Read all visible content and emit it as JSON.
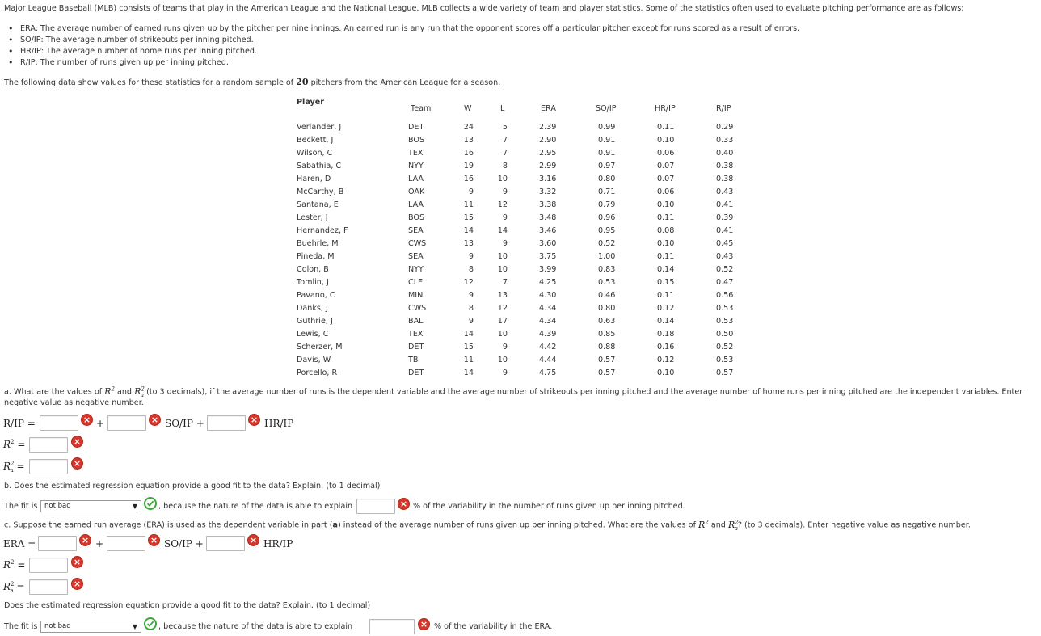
{
  "intro": "Major League Baseball (MLB) consists of teams that play in the American League and the National League. MLB collects a wide variety of team and player statistics. Some of the statistics often used to evaluate pitching performance are as follows:",
  "bullets": [
    "ERA: The average number of earned runs given up by the pitcher per nine innings. An earned run is any run that the opponent scores off a particular pitcher except for runs scored as a result of errors.",
    "SO/IP: The average number of strikeouts per inning pitched.",
    "HR/IP: The average number of home runs per inning pitched.",
    "R/IP: The number of runs given up per inning pitched."
  ],
  "following_pre": "The following data show values for these statistics for a random sample of ",
  "following_num": "20",
  "following_post": " pitchers from the American League for a season.",
  "table": {
    "player_header": "Player",
    "headers": [
      "Team",
      "W",
      "L",
      "ERA",
      "SO/IP",
      "HR/IP",
      "R/IP"
    ],
    "rows": [
      [
        "Verlander, J",
        "DET",
        "24",
        "5",
        "2.39",
        "0.99",
        "0.11",
        "0.29"
      ],
      [
        "Beckett, J",
        "BOS",
        "13",
        "7",
        "2.90",
        "0.91",
        "0.10",
        "0.33"
      ],
      [
        "Wilson, C",
        "TEX",
        "16",
        "7",
        "2.95",
        "0.91",
        "0.06",
        "0.40"
      ],
      [
        "Sabathia, C",
        "NYY",
        "19",
        "8",
        "2.99",
        "0.97",
        "0.07",
        "0.38"
      ],
      [
        "Haren, D",
        "LAA",
        "16",
        "10",
        "3.16",
        "0.80",
        "0.07",
        "0.38"
      ],
      [
        "McCarthy, B",
        "OAK",
        "9",
        "9",
        "3.32",
        "0.71",
        "0.06",
        "0.43"
      ],
      [
        "Santana, E",
        "LAA",
        "11",
        "12",
        "3.38",
        "0.79",
        "0.10",
        "0.41"
      ],
      [
        "Lester, J",
        "BOS",
        "15",
        "9",
        "3.48",
        "0.96",
        "0.11",
        "0.39"
      ],
      [
        "Hernandez, F",
        "SEA",
        "14",
        "14",
        "3.46",
        "0.95",
        "0.08",
        "0.41"
      ],
      [
        "Buehrle, M",
        "CWS",
        "13",
        "9",
        "3.60",
        "0.52",
        "0.10",
        "0.45"
      ],
      [
        "Pineda, M",
        "SEA",
        "9",
        "10",
        "3.75",
        "1.00",
        "0.11",
        "0.43"
      ],
      [
        "Colon, B",
        "NYY",
        "8",
        "10",
        "3.99",
        "0.83",
        "0.14",
        "0.52"
      ],
      [
        "Tomlin, J",
        "CLE",
        "12",
        "7",
        "4.25",
        "0.53",
        "0.15",
        "0.47"
      ],
      [
        "Pavano, C",
        "MIN",
        "9",
        "13",
        "4.30",
        "0.46",
        "0.11",
        "0.56"
      ],
      [
        "Danks, J",
        "CWS",
        "8",
        "12",
        "4.34",
        "0.80",
        "0.12",
        "0.53"
      ],
      [
        "Guthrie, J",
        "BAL",
        "9",
        "17",
        "4.34",
        "0.63",
        "0.14",
        "0.53"
      ],
      [
        "Lewis, C",
        "TEX",
        "14",
        "10",
        "4.39",
        "0.85",
        "0.18",
        "0.50"
      ],
      [
        "Scherzer, M",
        "DET",
        "15",
        "9",
        "4.42",
        "0.88",
        "0.16",
        "0.52"
      ],
      [
        "Davis, W",
        "TB",
        "11",
        "10",
        "4.44",
        "0.57",
        "0.12",
        "0.53"
      ],
      [
        "Porcello, R",
        "DET",
        "14",
        "9",
        "4.75",
        "0.57",
        "0.10",
        "0.57"
      ]
    ]
  },
  "part_a": {
    "question_1": "a. What are the values of ",
    "r2": "R²",
    "and": " and ",
    "ra2": "R",
    "ra2_sub": "a",
    "ra2_sup": "2",
    "question_2": " (to 3 decimals), if the average number of runs is the dependent variable and the average number of strikeouts per inning pitched and the average number of home runs per inning pitched are the independent variables. Enter",
    "question_3": "negative value as negative number.",
    "eq_lhs": "R/IP =",
    "plus": "+",
    "so_term": "SO/IP +",
    "hr_term": "HR/IP",
    "r2_label": "R² =",
    "ra2_label": "=",
    "inputs": {
      "b0": "",
      "b1": "",
      "b2": "",
      "r2": "",
      "ra2": ""
    }
  },
  "part_b": {
    "question": "b. Does the estimated regression equation provide a good fit to the data? Explain. (to 1 decimal)",
    "fit_prefix": "The fit is",
    "fit_select": "not bad",
    "because": ", because the nature of the data is able to explain",
    "pct_input": "",
    "suffix": "% of the variability in the number of runs given up per inning pitched."
  },
  "part_c": {
    "question_1": "c. Suppose the earned run average (ERA) is used as the dependent variable in part (",
    "question_a": "a",
    "question_2": ") instead of the average number of runs given up per inning pitched. What are the values of ",
    "question_3": "? (to 3 decimals). Enter negative value as negative number.",
    "eq_lhs": "ERA =",
    "plus": "+",
    "so_term": "SO/IP +",
    "hr_term": "HR/IP",
    "r2_label": "R² =",
    "ra2_label": "=",
    "inputs": {
      "b0": "",
      "b1": "",
      "b2": "",
      "r2": "",
      "ra2": ""
    },
    "fit_question": "Does the estimated regression equation provide a good fit to the data? Explain. (to 1 decimal)",
    "fit_prefix": "The fit is",
    "fit_select": "not bad",
    "because": ", because the nature of the data is able to explain",
    "pct_input": "",
    "suffix": "% of the variability in the ERA."
  },
  "icons": {
    "wrong": "x-circle-icon",
    "correct": "check-circle-icon"
  },
  "colors": {
    "wrong": "#d9362b",
    "correct": "#3aa83a",
    "text": "#333333"
  }
}
